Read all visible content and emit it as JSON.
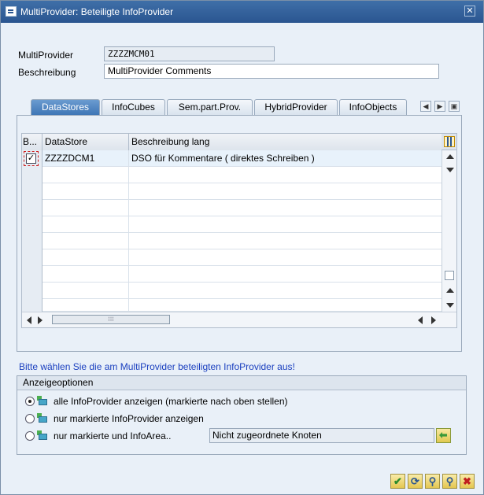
{
  "window": {
    "title": "MultiProvider: Beteiligte InfoProvider"
  },
  "form": {
    "multiprovider_label": "MultiProvider",
    "multiprovider_value": "ZZZZMCM01",
    "beschreibung_label": "Beschreibung",
    "beschreibung_value": "MultiProvider Comments"
  },
  "tabs": [
    {
      "label": "DataStores",
      "active": true
    },
    {
      "label": "InfoCubes",
      "active": false
    },
    {
      "label": "Sem.part.Prov.",
      "active": false
    },
    {
      "label": "HybridProvider",
      "active": false
    },
    {
      "label": "InfoObjects",
      "active": false
    }
  ],
  "table": {
    "columns": [
      "B...",
      "DataStore",
      "Beschreibung lang"
    ],
    "rows": [
      {
        "checked": true,
        "datastore": "ZZZZDCM1",
        "beschreibung": "DSO für Kommentare ( direktes Schreiben )"
      }
    ]
  },
  "message": "Bitte wählen Sie die am MultiProvider beteiligten InfoProvider aus!",
  "options": {
    "title": "Anzeigeoptionen",
    "items": [
      {
        "label": "alle InfoProvider anzeigen (markierte nach oben stellen)",
        "selected": true
      },
      {
        "label": "nur markierte InfoProvider anzeigen",
        "selected": false
      },
      {
        "label": "nur markierte und InfoArea..",
        "selected": false
      }
    ],
    "node_field_value": "Nicht zugeordnete Knoten"
  },
  "footer": {
    "buttons": [
      "confirm-icon",
      "refresh-icon",
      "find-icon",
      "find-next-icon",
      "cancel-icon"
    ]
  }
}
